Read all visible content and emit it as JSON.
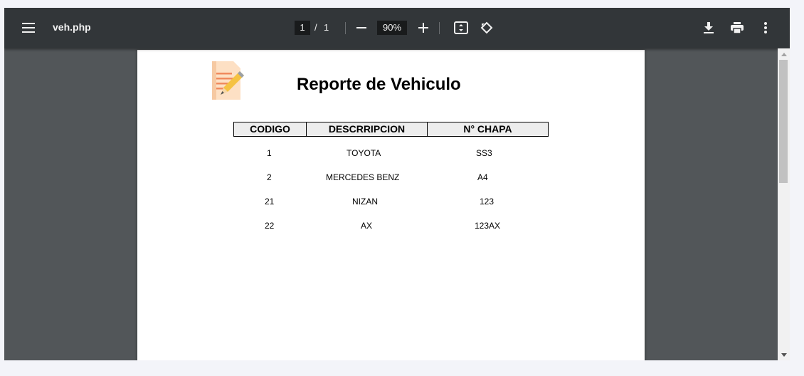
{
  "toolbar": {
    "title": "veh.php",
    "current_page": "1",
    "page_separator": "/",
    "total_pages": "1",
    "zoom": "90%",
    "icons": [
      "menu-icon",
      "zoom-out-icon",
      "zoom-in-icon",
      "fit-page-icon",
      "rotate-icon",
      "download-icon",
      "print-icon",
      "more-options-icon"
    ]
  },
  "document": {
    "title": "Reporte de Vehiculo",
    "columns": [
      "CODIGO",
      "DESCRRIPCION",
      "N° CHAPA"
    ],
    "rows": [
      {
        "codigo": "1",
        "descripcion": "TOYOTA",
        "chapa": "SS3"
      },
      {
        "codigo": "2",
        "descripcion": "MERCEDES BENZ",
        "chapa": "A4"
      },
      {
        "codigo": "21",
        "descripcion": "NIZAN",
        "chapa": "123"
      },
      {
        "codigo": "22",
        "descripcion": "AX",
        "chapa": "123AX"
      }
    ]
  },
  "colors": {
    "toolbar_bg": "#323639",
    "viewer_bg": "#525659",
    "header_row_bg": "#ededed"
  }
}
